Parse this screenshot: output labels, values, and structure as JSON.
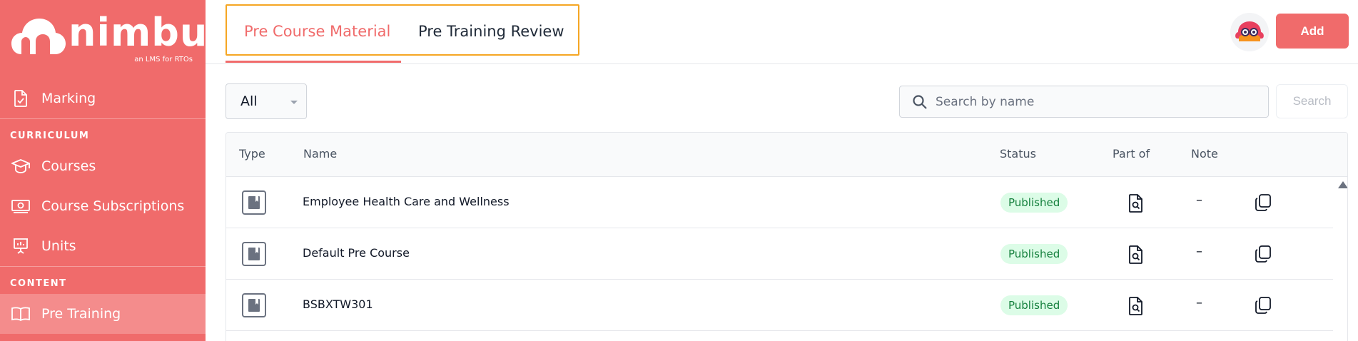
{
  "brand": {
    "name": "nimbu",
    "tagline": "an LMS for RTOs",
    "accent": "#f06b6b"
  },
  "sidebar": {
    "items": [
      {
        "label": "Marking",
        "icon": "document-check-icon"
      },
      {
        "label": "Courses",
        "icon": "graduation-cap-icon"
      },
      {
        "label": "Course Subscriptions",
        "icon": "money-icon"
      },
      {
        "label": "Units",
        "icon": "presentation-chart-icon"
      },
      {
        "label": "Pre Training",
        "icon": "book-open-icon",
        "active": true
      }
    ],
    "sections": {
      "curriculum": "CURRICULUM",
      "content": "CONTENT"
    }
  },
  "tabs": [
    {
      "label": "Pre Course Material",
      "active": true
    },
    {
      "label": "Pre Training Review",
      "active": false
    }
  ],
  "header": {
    "add_label": "Add"
  },
  "filter": {
    "selected": "All"
  },
  "search": {
    "placeholder": "Search by name",
    "button_label": "Search"
  },
  "table": {
    "columns": [
      "Type",
      "Name",
      "Status",
      "Part of",
      "Note"
    ],
    "rows": [
      {
        "name": "Employee Health Care and Wellness",
        "status": "Published",
        "note": "–"
      },
      {
        "name": "Default Pre Course",
        "status": "Published",
        "note": "–"
      },
      {
        "name": "BSBXTW301",
        "status": "Published",
        "note": "–"
      }
    ]
  }
}
